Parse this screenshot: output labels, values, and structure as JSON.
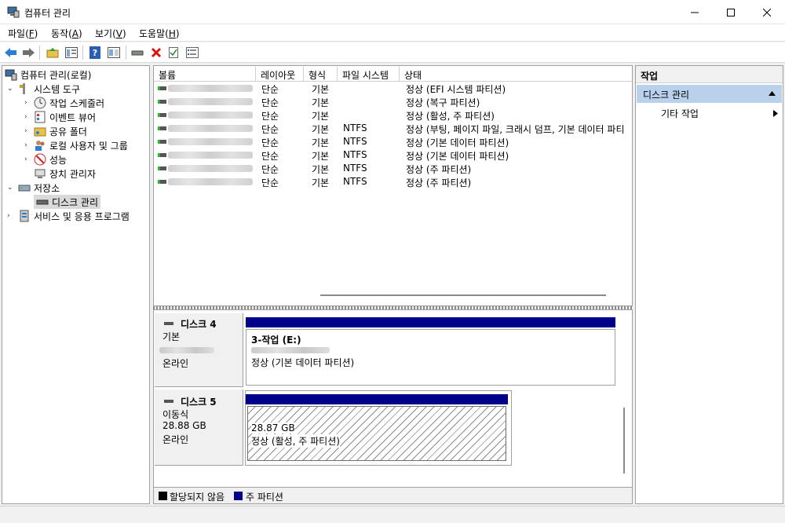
{
  "window": {
    "title": "컴퓨터 관리",
    "icons": {
      "app": "computer-management-icon",
      "minimize": "minimize-icon",
      "maximize": "maximize-icon",
      "close": "close-icon"
    }
  },
  "menu": [
    {
      "label": "파일(",
      "key": "F",
      "end": ")"
    },
    {
      "label": "동작(",
      "key": "A",
      "end": ")"
    },
    {
      "label": "보기(",
      "key": "V",
      "end": ")"
    },
    {
      "label": "도움말(",
      "key": "H",
      "end": ")"
    }
  ],
  "toolbar": {
    "icons": [
      "back-arrow-icon",
      "forward-arrow-icon",
      "folder-up-icon",
      "show-hide-tree-icon",
      "help-icon",
      "properties-icon",
      "connect-drive-icon",
      "delete-icon",
      "check-icon",
      "list-icon"
    ]
  },
  "tree": [
    {
      "label": "컴퓨터 관리(로컬)",
      "icon": "computer-management-icon"
    },
    {
      "label": "시스템 도구",
      "icon": "tools-icon"
    },
    {
      "label": "작업 스케줄러",
      "icon": "clock-icon"
    },
    {
      "label": "이벤트 뷰어",
      "icon": "event-viewer-icon"
    },
    {
      "label": "공유 폴더",
      "icon": "shared-folder-icon"
    },
    {
      "label": "로컬 사용자 및 그룹",
      "icon": "users-icon"
    },
    {
      "label": "성능",
      "icon": "performance-icon"
    },
    {
      "label": "장치 관리자",
      "icon": "device-manager-icon"
    },
    {
      "label": "저장소",
      "icon": "storage-icon"
    },
    {
      "label": "디스크 관리",
      "icon": "disk-icon"
    },
    {
      "label": "서비스 및 응용 프로그램",
      "icon": "services-icon"
    }
  ],
  "volumes": {
    "columns": [
      "볼륨",
      "레이아웃",
      "형식",
      "파일 시스템",
      "상태"
    ],
    "rows": [
      {
        "layout": "단순",
        "type": "기본",
        "fs": "",
        "status": "정상 (EFI 시스템 파티션)"
      },
      {
        "layout": "단순",
        "type": "기본",
        "fs": "",
        "status": "정상 (복구 파티션)"
      },
      {
        "layout": "단순",
        "type": "기본",
        "fs": "",
        "status": "정상 (활성, 주 파티션)"
      },
      {
        "layout": "단순",
        "type": "기본",
        "fs": "NTFS",
        "status": "정상 (부팅, 페이지 파일, 크래시 덤프, 기본 데이터 파티"
      },
      {
        "layout": "단순",
        "type": "기본",
        "fs": "NTFS",
        "status": "정상 (기본 데이터 파티션)"
      },
      {
        "layout": "단순",
        "type": "기본",
        "fs": "NTFS",
        "status": "정상 (기본 데이터 파티션)"
      },
      {
        "layout": "단순",
        "type": "기본",
        "fs": "NTFS",
        "status": "정상 (주 파티션)"
      },
      {
        "layout": "단순",
        "type": "기본",
        "fs": "NTFS",
        "status": "정상 (주 파티션)"
      }
    ]
  },
  "disks": [
    {
      "name": "디스크 4",
      "type": "기본",
      "status": "온라인",
      "partition": {
        "title": "3-작업  (E:)",
        "status": "정상 (기본 데이터 파티션)"
      }
    },
    {
      "name": "디스크 5",
      "type": "이동식",
      "size": "28.88 GB",
      "status": "온라인",
      "partition": {
        "size": "28.87 GB",
        "status": "정상 (활성, 주 파티션)"
      }
    }
  ],
  "legend": [
    {
      "label": "할당되지 않음",
      "color": "#000000"
    },
    {
      "label": "주 파티션",
      "color": "#00008b"
    }
  ],
  "actions": {
    "header": "작업",
    "section": "디스크 관리",
    "item": "기타 작업"
  }
}
